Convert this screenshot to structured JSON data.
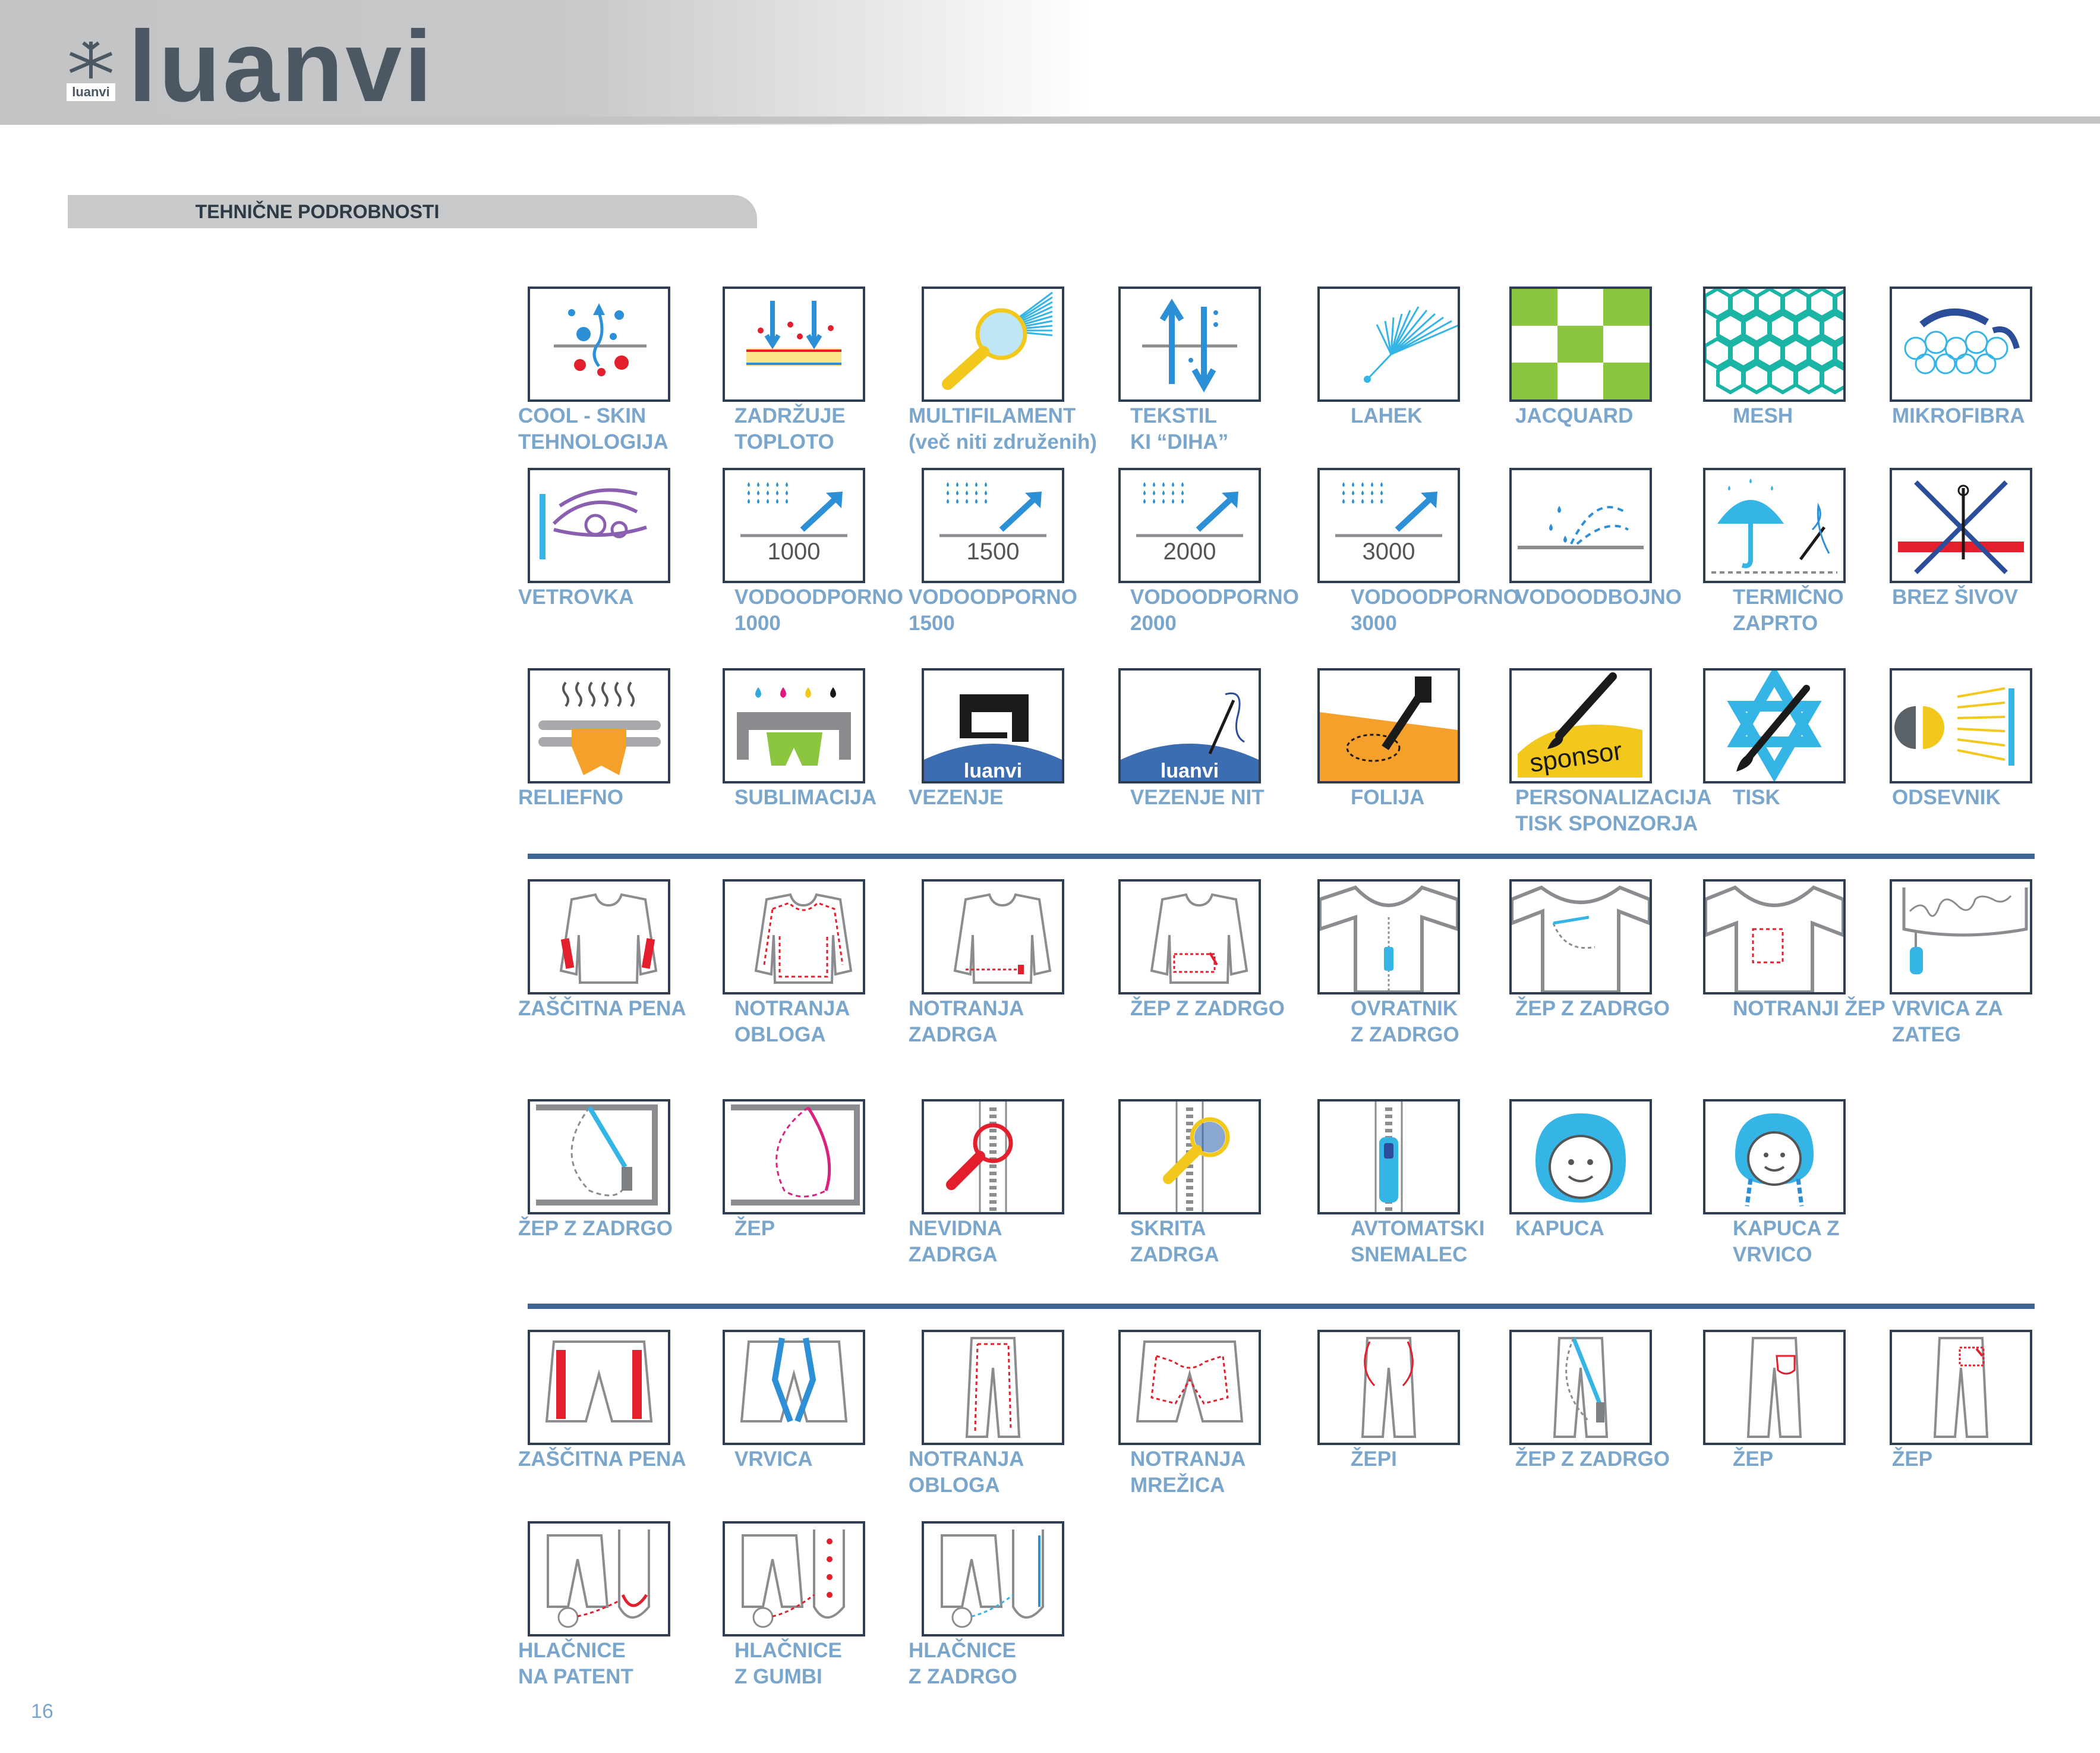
{
  "brand": {
    "name": "luanvi",
    "mark_text": "luanvi"
  },
  "section": {
    "title": "TEHNIČNE PODROBNOSTI"
  },
  "page_number": "16",
  "features": [
    {
      "label": "COOL - SKIN\nTEHNOLOGIJA",
      "icon": "cool-skin-icon"
    },
    {
      "label": "ZADRŽUJE\nTOPLOTO",
      "icon": "heat-retention-icon"
    },
    {
      "label": "MULTIFILAMENT\n(več niti združenih)",
      "icon": "multifilament-icon"
    },
    {
      "label": "TEKSTIL\nKI “DIHA”",
      "icon": "breathable-icon"
    },
    {
      "label": "LAHEK",
      "icon": "lightweight-icon"
    },
    {
      "label": "JACQUARD",
      "icon": "jacquard-icon"
    },
    {
      "label": "MESH",
      "icon": "mesh-icon"
    },
    {
      "label": "MIKROFIBRA",
      "icon": "microfiber-icon"
    },
    {
      "label": "VETROVKA",
      "icon": "windbreaker-icon"
    },
    {
      "label": "VODOODPORNO\n1000",
      "icon": "waterproof-icon",
      "value": "1000"
    },
    {
      "label": "VODOODPORNO\n1500",
      "icon": "waterproof-icon",
      "value": "1500"
    },
    {
      "label": "VODOODPORNO\n2000",
      "icon": "waterproof-icon",
      "value": "2000"
    },
    {
      "label": "VODOODPORNO\n3000",
      "icon": "waterproof-icon",
      "value": "3000"
    },
    {
      "label": "VODOODBOJNO",
      "icon": "water-repellent-icon"
    },
    {
      "label": "TERMIČNO\nZAPRTO",
      "icon": "thermo-sealed-icon"
    },
    {
      "label": "BREZ ŠIVOV",
      "icon": "seamless-icon"
    },
    {
      "label": "RELIEFNO",
      "icon": "embossed-icon"
    },
    {
      "label": "SUBLIMACIJA",
      "icon": "sublimation-icon"
    },
    {
      "label": "VEZENJE",
      "icon": "embroidery-icon",
      "mark": "luanvi"
    },
    {
      "label": "VEZENJE NIT",
      "icon": "embroidery-thread-icon",
      "mark": "luanvi"
    },
    {
      "label": "FOLIJA",
      "icon": "foil-icon"
    },
    {
      "label": "PERSONALIZACIJA\nTISK SPONZORJA",
      "icon": "sponsor-print-icon",
      "mark": "sponsor"
    },
    {
      "label": "TISK",
      "icon": "print-icon"
    },
    {
      "label": "ODSEVNIK",
      "icon": "reflective-icon"
    },
    {
      "label": "ZAŠČITNA PENA",
      "icon": "shirt-padding-icon"
    },
    {
      "label": "NOTRANJA\nOBLOGA",
      "icon": "shirt-lining-icon"
    },
    {
      "label": "NOTRANJA\nZADRGA",
      "icon": "shirt-inner-zip-icon"
    },
    {
      "label": "ŽEP Z ZADRGO",
      "icon": "shirt-zip-pocket-icon"
    },
    {
      "label": "OVRATNIK\nZ ZADRGO",
      "icon": "zip-collar-icon"
    },
    {
      "label": "ŽEP Z ZADRGO",
      "icon": "sleeve-zip-pocket-icon"
    },
    {
      "label": "NOTRANJI ŽEP",
      "icon": "inner-pocket-icon"
    },
    {
      "label": "VRVICA ZA\nZATEG",
      "icon": "drawcord-icon"
    },
    {
      "label": "ŽEP Z ZADRGO",
      "icon": "zip-pocket-icon"
    },
    {
      "label": "ŽEP",
      "icon": "pocket-icon"
    },
    {
      "label": "NEVIDNA\nZADRGA",
      "icon": "invisible-zip-icon"
    },
    {
      "label": "SKRITA\nZADRGA",
      "icon": "hidden-zip-icon"
    },
    {
      "label": "AVTOMATSKI\nSNEMALEC",
      "icon": "auto-lock-zip-icon"
    },
    {
      "label": "KAPUCA",
      "icon": "hood-icon"
    },
    {
      "label": "KAPUCA Z\nVRVICO",
      "icon": "hood-drawcord-icon"
    },
    {
      "label": "ZAŠČITNA PENA",
      "icon": "shorts-padding-icon"
    },
    {
      "label": "VRVICA",
      "icon": "shorts-drawcord-icon"
    },
    {
      "label": "NOTRANJA\nOBLOGA",
      "icon": "pants-lining-icon"
    },
    {
      "label": "NOTRANJA\nMREŽICA",
      "icon": "shorts-mesh-icon"
    },
    {
      "label": "ŽEPI",
      "icon": "pants-pockets-icon"
    },
    {
      "label": "ŽEP Z ZADRGO",
      "icon": "pants-zip-pocket-icon"
    },
    {
      "label": "ŽEP",
      "icon": "pants-back-pocket-icon"
    },
    {
      "label": "ŽEP",
      "icon": "pants-zip-back-pocket-icon"
    },
    {
      "label": "HLAČNICE\nNA PATENT",
      "icon": "snap-hem-icon"
    },
    {
      "label": "HLAČNICE\nZ GUMBI",
      "icon": "button-hem-icon"
    },
    {
      "label": "HLAČNICE\nZ ZADRGO",
      "icon": "zip-hem-icon"
    }
  ]
}
